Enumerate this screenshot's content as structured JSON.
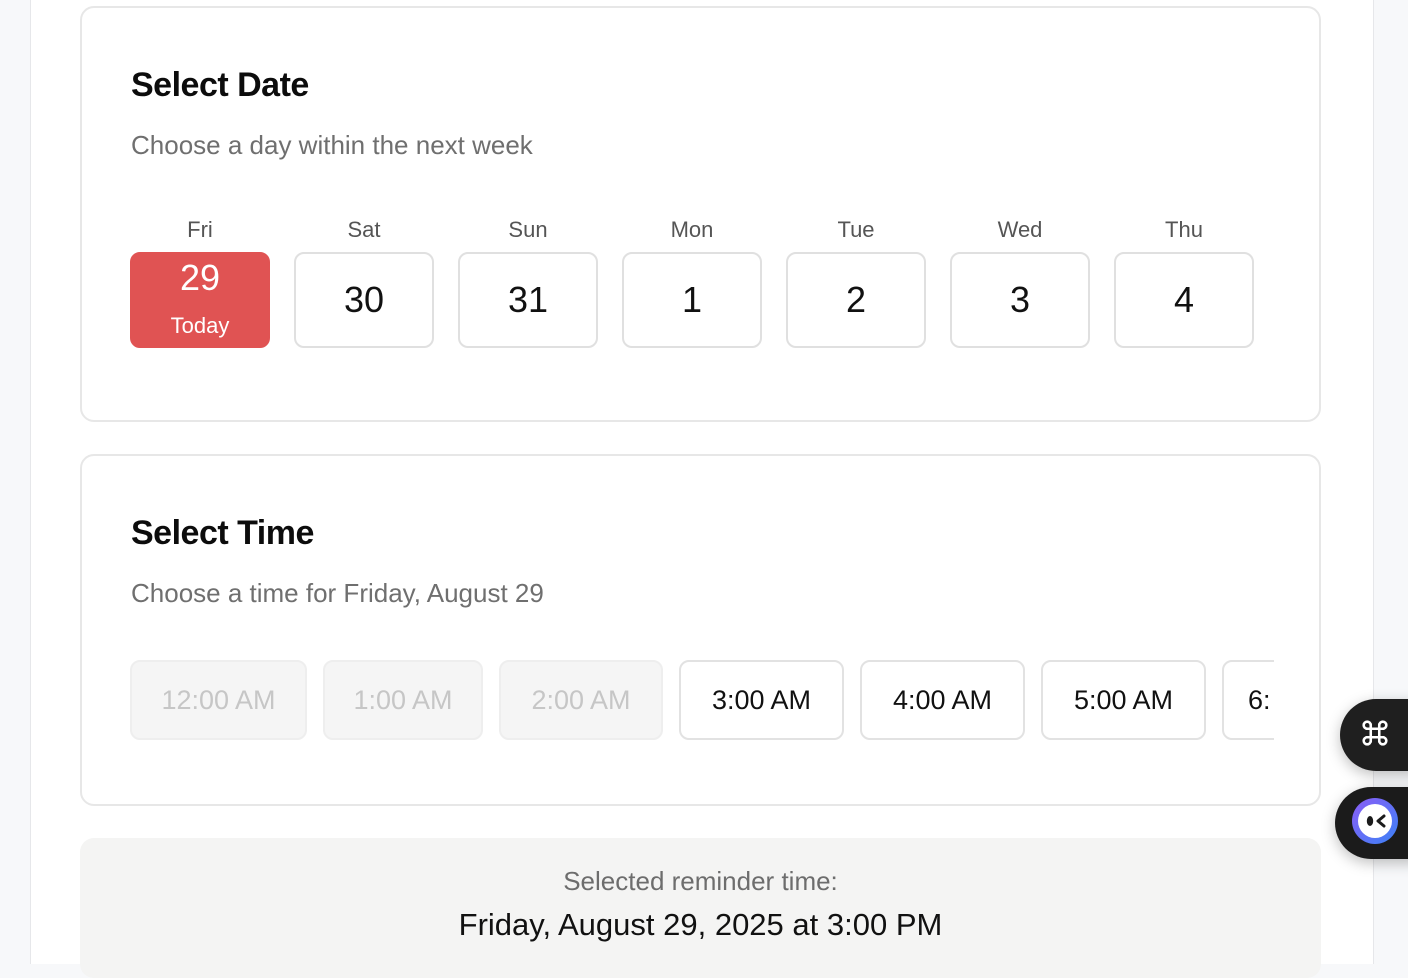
{
  "date_card": {
    "title": "Select Date",
    "subtitle": "Choose a day within the next week",
    "days": [
      {
        "dow": "Fri",
        "num": "29",
        "note": "Today"
      },
      {
        "dow": "Sat",
        "num": "30"
      },
      {
        "dow": "Sun",
        "num": "31"
      },
      {
        "dow": "Mon",
        "num": "1"
      },
      {
        "dow": "Tue",
        "num": "2"
      },
      {
        "dow": "Wed",
        "num": "3"
      },
      {
        "dow": "Thu",
        "num": "4"
      }
    ],
    "selected_index": 0,
    "selected_color": "#e05353"
  },
  "time_card": {
    "title": "Select Time",
    "subtitle": "Choose a time for Friday, August 29",
    "slots": [
      {
        "label": "12:00 AM",
        "disabled": true
      },
      {
        "label": "1:00 AM",
        "disabled": true
      },
      {
        "label": "2:00 AM",
        "disabled": true
      },
      {
        "label": "3:00 AM",
        "disabled": false
      },
      {
        "label": "4:00 AM",
        "disabled": false
      },
      {
        "label": "5:00 AM",
        "disabled": false
      },
      {
        "label": "6:",
        "disabled": false
      }
    ]
  },
  "summary": {
    "label": "Selected reminder time:",
    "value": "Friday, August 29, 2025 at 3:00 PM"
  },
  "floating_buttons": {
    "command_icon": "command-icon",
    "assistant_icon": "assistant-face-icon"
  }
}
